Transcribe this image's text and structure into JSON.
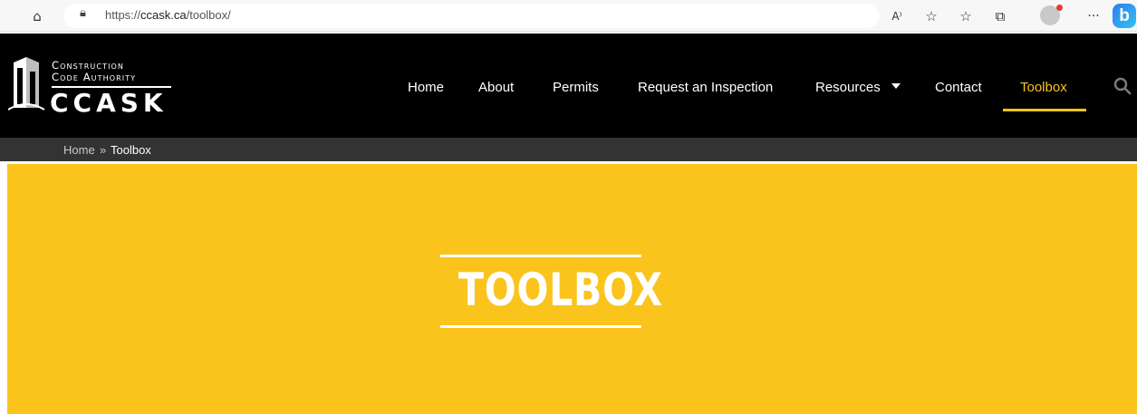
{
  "browser": {
    "url_prefix": "https://",
    "url_host": "ccask.ca",
    "url_path": "/toolbox/",
    "icons": [
      "home-icon",
      "lock-icon",
      "read-aloud-icon",
      "add-favorite-icon",
      "favorites-icon",
      "collections-icon",
      "profile-icon",
      "more-icon",
      "bing-icon"
    ],
    "read_aloud_glyph": "A⁾",
    "more_glyph": "···",
    "bing_glyph": "b"
  },
  "logo": {
    "line1": "Construction",
    "line2": "Code Authority",
    "big": "CCASK"
  },
  "nav": {
    "items": [
      {
        "label": "Home",
        "active": false
      },
      {
        "label": "About",
        "active": false
      },
      {
        "label": "Permits",
        "active": false
      },
      {
        "label": "Request an Inspection",
        "active": false
      },
      {
        "label": "Resources",
        "active": false,
        "has_dropdown": true
      },
      {
        "label": "Contact",
        "active": false
      },
      {
        "label": "Toolbox",
        "active": true
      }
    ],
    "search_icon": "search-icon"
  },
  "breadcrumb": {
    "home": "Home",
    "separator": "»",
    "current": "Toolbox"
  },
  "hero": {
    "title": "TOOLBOX"
  },
  "colors": {
    "accent": "#f9c31f",
    "hero_bg": "#fac41d",
    "header_bg": "#000000",
    "breadcrumb_bg": "#333333"
  }
}
